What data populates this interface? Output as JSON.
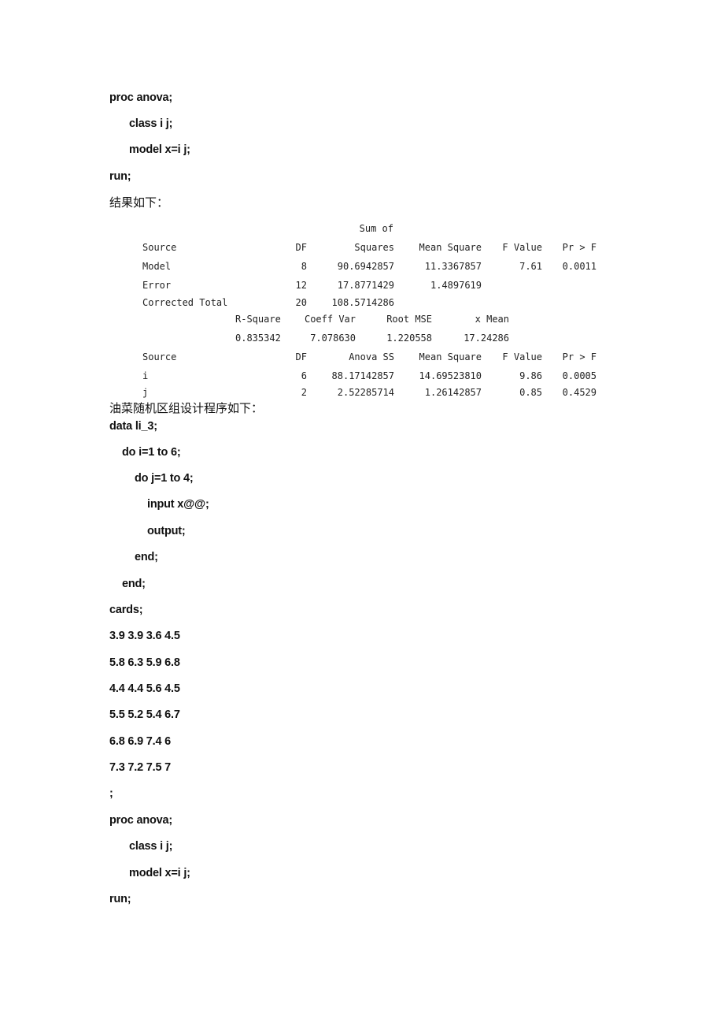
{
  "code_block_1": {
    "lines": [
      "proc anova;",
      "class i j;",
      "model x=i j;",
      "run;"
    ]
  },
  "result_heading": "结果如下：",
  "anova_output": {
    "sum_of_label": "Sum of",
    "header": {
      "source": "Source",
      "df": "DF",
      "ss": "Squares",
      "ms": "Mean Square",
      "f": "F Value",
      "p": "Pr > F"
    },
    "rows": [
      {
        "source": "Model",
        "df": "8",
        "ss": "90.6942857",
        "ms": "11.3367857",
        "f": "7.61",
        "p": "0.0011"
      },
      {
        "source": "Error",
        "df": "12",
        "ss": "17.8771429",
        "ms": "1.4897619",
        "f": "",
        "p": ""
      },
      {
        "source": "Corrected Total",
        "df": "20",
        "ss": "108.5714286",
        "ms": "",
        "f": "",
        "p": ""
      }
    ],
    "fit_stats": {
      "headers": [
        "R-Square",
        "Coeff Var",
        "Root MSE",
        "x Mean"
      ],
      "values": [
        "0.835342",
        "7.078630",
        "1.220558",
        "17.24286"
      ]
    },
    "effects_header": {
      "source": "Source",
      "df": "DF",
      "ss": "Anova SS",
      "ms": "Mean Square",
      "f": "F Value",
      "p": "Pr > F"
    },
    "effects": [
      {
        "source": "i",
        "df": "6",
        "ss": "88.17142857",
        "ms": "14.69523810",
        "f": "9.86",
        "p": "0.0005"
      },
      {
        "source": "j",
        "df": "2",
        "ss": "2.52285714",
        "ms": "1.26142857",
        "f": "0.85",
        "p": "0.4529"
      }
    ]
  },
  "program_heading": "油菜随机区组设计程序如下：",
  "code_block_2": {
    "data_line": "data li_3;",
    "do_i": "do i=1 to 6;",
    "do_j": "do j=1 to 4;",
    "input": "input x@@;",
    "output": "output;",
    "end_inner": "end;",
    "end_outer": "end;",
    "cards": "cards;",
    "card_rows": [
      "3.9 3.9 3.6 4.5",
      "5.8 6.3 5.9 6.8",
      "4.4 4.4 5.6 4.5",
      "5.5 5.2 5.4 6.7",
      "6.8 6.9 7.4 6",
      "7.3 7.2 7.5 7"
    ],
    "semicolon": ";",
    "proc": "proc anova;",
    "class": "class i j;",
    "model": "model x=i j;",
    "run": "run;"
  }
}
